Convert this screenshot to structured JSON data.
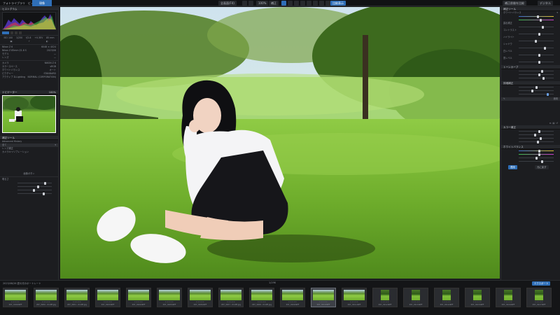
{
  "topbar": {
    "tabs": [
      "フォトライブラリ",
      "ビュー",
      "現像"
    ],
    "zoom_label": "全画面(F4)",
    "fit_label": "100%",
    "adjust_label": "補正",
    "compare_label": "比較表示",
    "right_labels": [
      "補正前後を比較",
      "デジタル"
    ]
  },
  "left": {
    "histogram_title": "ヒストグラム",
    "exif_row": [
      "ISO 100",
      "1/250",
      "f/2.8",
      "+0.3EV",
      "85 mm"
    ],
    "info_rows": [
      {
        "k": "Nikon Z 6",
        "v": "6048 × 4024"
      },
      {
        "k": "Nikon Z 85mm f/1.8 S",
        "v": "2023/08"
      },
      {
        "k": "モデル",
        "v": "—"
      },
      {
        "k": "レンズ",
        "v": "—"
      }
    ],
    "meta_rows": [
      {
        "k": "カメラ",
        "v": "NIKON Z 6"
      },
      {
        "k": "カラースペース",
        "v": "sRGB"
      },
      {
        "k": "ホワイトバランス",
        "v": "オート"
      },
      {
        "k": "ピクチャー",
        "v": "STANDARD"
      },
      {
        "k": "アクティブ D-Lighting",
        "v": "NORMAL (CORPORATION)"
      }
    ],
    "navigator_title": "ナビゲーター",
    "navigator_zoom": "100%",
    "history_title": "補正ツール",
    "history_items": [
      "Advanced History",
      "補正",
      "レンズ補正",
      "カメラキャリブレーション"
    ],
    "history_value": "全て",
    "bottom_title": "画像ボタン",
    "slider_rows": [
      "明るさ",
      "コントラスト",
      "ハイライト",
      "シャドウ",
      "ホワイト",
      "ブラック"
    ]
  },
  "right": {
    "section1": "補正ツール",
    "section1_rows": [
      "ホワイトバランス",
      "色温度",
      "色かぶり補正",
      "露出補正",
      "コントラスト",
      "ハイライト",
      "シャドウ",
      "白レベル",
      "黒レベル"
    ],
    "section2": "トーンカーブ",
    "section2_rows": [
      "明瞭度",
      "彩度",
      "自然な彩度"
    ],
    "section3": "詳細補正",
    "section3_rows": [
      "シャープネス",
      "ノイズ除去",
      "輝度",
      "カラー"
    ],
    "section4": "カラー補正",
    "section4_rows": [
      "色相",
      "彩度",
      "明度",
      "全体"
    ],
    "section5": "ホワイトバランス",
    "section5_rows": [
      "色温度",
      "色かぶり補正",
      "露出補正",
      "コントラスト"
    ],
    "apply_button": "適用",
    "reset_button": "元に戻す"
  },
  "filmstrip": {
    "path": "2023/08/26 夏の光のポートレート",
    "counter": "1/196",
    "export_button": "エクスポート",
    "thumbs": [
      {
        "name": "297_3199.NEF",
        "tone": "landscape"
      },
      {
        "name": "297_3200 - 01.NE.jpg",
        "tone": "landscape"
      },
      {
        "name": "297_3201 - 01.NE.jpg",
        "tone": "landscape"
      },
      {
        "name": "297_3203.NEF",
        "tone": "landscape"
      },
      {
        "name": "297_3204.NEF",
        "tone": "landscape"
      },
      {
        "name": "297_3205.NEF",
        "tone": "landscape"
      },
      {
        "name": "297_3206.NEF",
        "tone": "landscape"
      },
      {
        "name": "297_3207 - 01.NE.jpg",
        "tone": "landscape"
      },
      {
        "name": "297_3208 - 01.NE.jpg",
        "tone": "landscape"
      },
      {
        "name": "297_3209.NEF",
        "tone": "landscape"
      },
      {
        "name": "297_3210.NEF",
        "tone": "landscape"
      },
      {
        "name": "297_3211.NEF",
        "tone": "landscape"
      },
      {
        "name": "297_3212.NEF",
        "tone": "portrait"
      },
      {
        "name": "297_3213.NEF",
        "tone": "portrait"
      },
      {
        "name": "297_3214.NEF",
        "tone": "portrait"
      },
      {
        "name": "297_3215.NEF",
        "tone": "portrait"
      },
      {
        "name": "297_3216.NEF",
        "tone": "portrait"
      },
      {
        "name": "297_3217.NEF",
        "tone": "portrait"
      }
    ]
  },
  "colors": {
    "accent": "#2f6fb8",
    "panel": "#1c1d20",
    "grass": "#6fae2c"
  }
}
